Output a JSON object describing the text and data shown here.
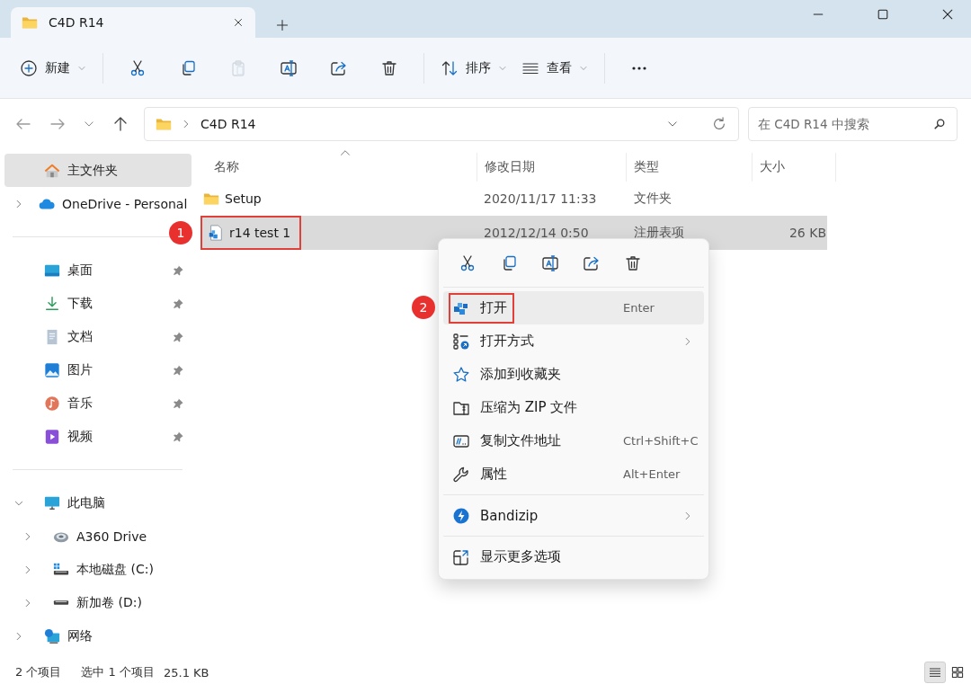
{
  "window": {
    "tab": {
      "title": "C4D R14"
    }
  },
  "toolbar": [
    {
      "kind": "new",
      "label": "新建",
      "dropdown": true,
      "disabled": false
    },
    {
      "kind": "cut",
      "disabled": false
    },
    {
      "kind": "copy",
      "disabled": false
    },
    {
      "kind": "paste",
      "disabled": true
    },
    {
      "kind": "rename",
      "disabled": false
    },
    {
      "kind": "share",
      "disabled": false
    },
    {
      "kind": "delete",
      "disabled": false
    },
    {
      "kind": "sort",
      "label": "排序",
      "dropdown": true,
      "disabled": false
    },
    {
      "kind": "view",
      "label": "查看",
      "dropdown": true,
      "disabled": false
    },
    {
      "kind": "more",
      "disabled": false
    }
  ],
  "address": {
    "breadcrumb": [
      "C4D R14"
    ],
    "search": {
      "placeholder": "在 C4D R14 中搜索"
    }
  },
  "sidebar": {
    "sections": [
      {
        "items": [
          {
            "kind": "home",
            "label": "主文件夹",
            "selected": true
          },
          {
            "kind": "cloud",
            "label": "OneDrive - Personal",
            "selected": false,
            "expanded": false
          }
        ]
      },
      {
        "items": [
          {
            "kind": "desktop",
            "label": "桌面",
            "selected": false,
            "pinned": true
          },
          {
            "kind": "download",
            "label": "下载",
            "selected": false,
            "pinned": true
          },
          {
            "kind": "document",
            "label": "文档",
            "selected": false,
            "pinned": true
          },
          {
            "kind": "pictures",
            "label": "图片",
            "selected": false,
            "pinned": true
          },
          {
            "kind": "music",
            "label": "音乐",
            "selected": false,
            "pinned": true
          },
          {
            "kind": "video",
            "label": "视频",
            "selected": false,
            "pinned": true
          }
        ]
      },
      {
        "items": [
          {
            "kind": "computer",
            "label": "此电脑",
            "selected": false,
            "expanded": true,
            "children": [
              {
                "kind": "cloud-drive",
                "label": "A360 Drive",
                "selected": false,
                "expanded": false
              },
              {
                "kind": "system-disk",
                "label": "本地磁盘 (C:)",
                "selected": false,
                "expanded": false
              },
              {
                "kind": "disk",
                "label": "新加卷 (D:)",
                "selected": false,
                "expanded": false
              }
            ]
          },
          {
            "kind": "network",
            "label": "网络",
            "selected": false,
            "expanded": false
          }
        ]
      }
    ]
  },
  "files": {
    "columns": [
      {
        "label": "名称",
        "sorted": true
      },
      {
        "label": "修改日期",
        "sorted": false
      },
      {
        "label": "类型",
        "sorted": false
      },
      {
        "label": "大小",
        "sorted": false
      }
    ],
    "rows": [
      {
        "kind": "folder",
        "name": "Setup",
        "date": "2020/11/17 11:33",
        "type": "文件夹",
        "selected": false,
        "highlighted": false
      },
      {
        "kind": "registry",
        "name": "r14 test 1",
        "date": "2012/12/14 0:50",
        "type": "注册表项",
        "size": "26 KB",
        "selected": true,
        "highlighted": true,
        "marker": "1"
      }
    ]
  },
  "context_menu": {
    "quick_actions": [
      {
        "kind": "cut"
      },
      {
        "kind": "copy"
      },
      {
        "kind": "rename"
      },
      {
        "kind": "share"
      },
      {
        "kind": "delete"
      }
    ],
    "groups": [
      [
        {
          "kind": "open",
          "label": "打开",
          "shortcut": "Enter",
          "hovered": true,
          "highlighted": true,
          "marker": "2"
        },
        {
          "kind": "open-with",
          "label": "打开方式",
          "submenu": true,
          "hovered": false
        },
        {
          "kind": "favorite",
          "label": "添加到收藏夹",
          "hovered": false
        },
        {
          "kind": "zip",
          "label": "压缩为 ZIP 文件",
          "hovered": false
        },
        {
          "kind": "copy-path",
          "label": "复制文件地址",
          "shortcut": "Ctrl+Shift+C",
          "hovered": false
        },
        {
          "kind": "properties",
          "label": "属性",
          "shortcut": "Alt+Enter",
          "hovered": false
        }
      ],
      [
        {
          "kind": "bandizip",
          "label": "Bandizip",
          "submenu": true,
          "hovered": false
        }
      ],
      [
        {
          "kind": "more-options",
          "label": "显示更多选项",
          "hovered": false
        }
      ]
    ]
  },
  "status_bar": {
    "count": "2 个项目",
    "selection": "选中 1 个项目",
    "size": "25.1 KB",
    "views": [
      {
        "kind": "details",
        "selected": true
      },
      {
        "kind": "tiles",
        "selected": false
      }
    ]
  }
}
